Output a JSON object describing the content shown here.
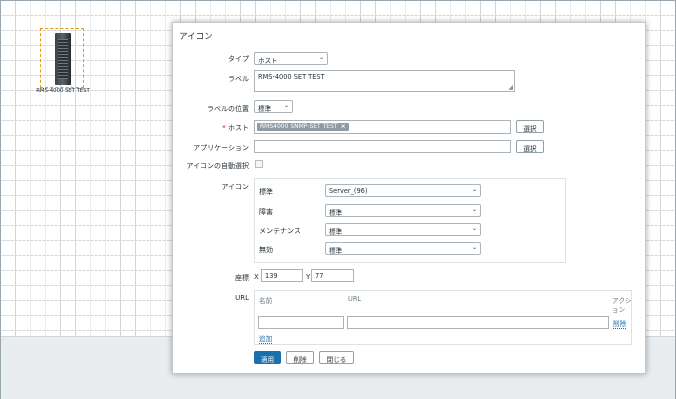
{
  "map": {
    "element_label": "RMS-4000 SET TEST",
    "element_icon": "server-icon"
  },
  "dialog": {
    "title": "アイコン",
    "type": {
      "label": "タイプ",
      "value": "ホスト"
    },
    "label": {
      "label": "ラベル",
      "value": "RMS-4000 SET TEST"
    },
    "label_position": {
      "label": "ラベルの位置",
      "value": "標準"
    },
    "host": {
      "required_mark": "*",
      "label": "ホスト",
      "chip": "RMS4000 SNMP-SET TEST",
      "chip_remove": "×",
      "select_button": "選択"
    },
    "application": {
      "label": "アプリケーション",
      "value": "",
      "select_button": "選択"
    },
    "auto_icon": {
      "label": "アイコンの自動選択",
      "checked": false
    },
    "icons": {
      "label": "アイコン",
      "rows": [
        {
          "label": "標準",
          "value": "Server_(96)"
        },
        {
          "label": "障害",
          "value": "標準"
        },
        {
          "label": "メンテナンス",
          "value": "標準"
        },
        {
          "label": "無効",
          "value": "標準"
        }
      ]
    },
    "coords": {
      "label": "座標",
      "x_label": "X",
      "x_value": "139",
      "y_label": "Y",
      "y_value": "77"
    },
    "urls": {
      "label": "URL",
      "col_name": "名前",
      "col_url": "URL",
      "col_action_1": "アクシ",
      "col_action_2": "ョン",
      "row_name": "",
      "row_url": "",
      "remove_link": "削除",
      "add_link": "追加"
    },
    "buttons": {
      "apply": "適用",
      "delete": "削除",
      "close": "閉じる"
    }
  },
  "colors": {
    "primary": "#1a6fad",
    "selection_border": "#e39a0e",
    "link": "#1a6ea8"
  }
}
